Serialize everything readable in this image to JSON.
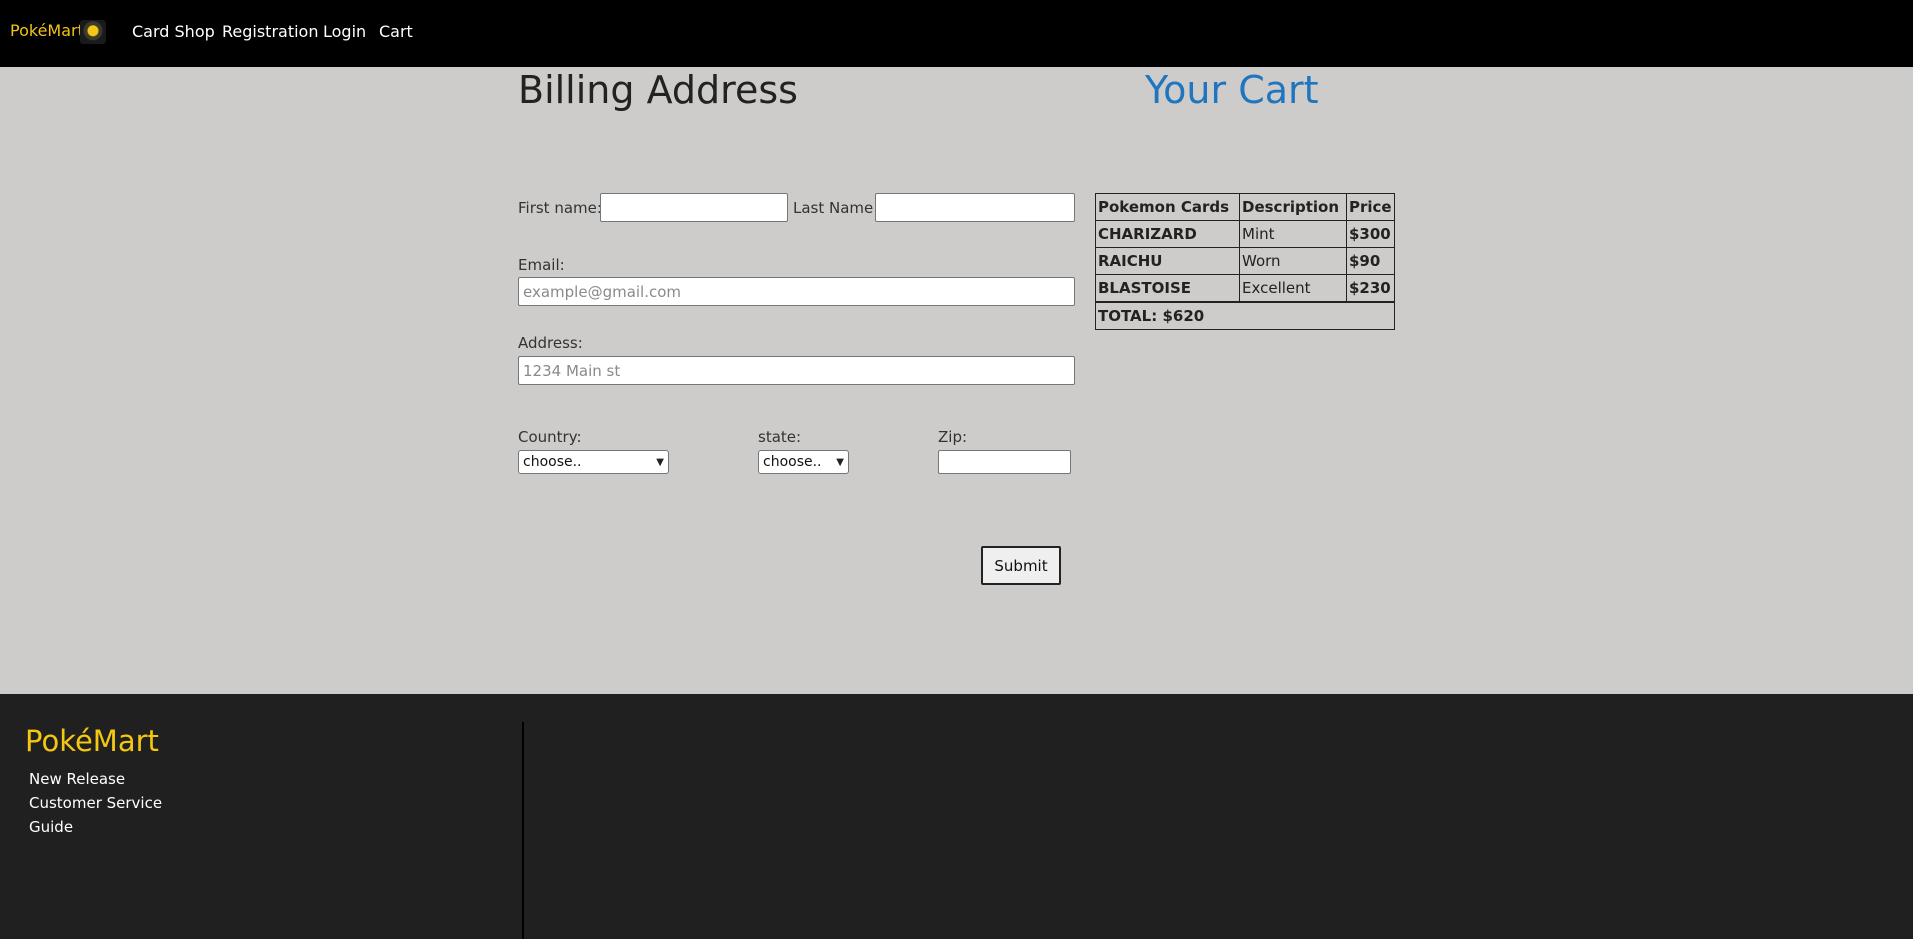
{
  "nav": {
    "brand": "PokéMart",
    "links": [
      "Card Shop",
      "Registration",
      "Login",
      "Cart"
    ]
  },
  "billing": {
    "title": "Billing Address",
    "first_name_label": "First name:",
    "first_name_value": "",
    "last_name_label": "Last Name:",
    "last_name_value": "",
    "email_label": "Email:",
    "email_placeholder": "example@gmail.com",
    "address_label": "Address:",
    "address_placeholder": "1234 Main st",
    "country_label": "Country:",
    "country_selected": "choose..",
    "state_label": "state:",
    "state_selected": "choose..",
    "zip_label": "Zip:",
    "zip_value": "",
    "submit_label": "Submit"
  },
  "cart": {
    "title": "Your Cart",
    "headers": [
      "Pokemon Cards",
      "Description",
      "Price"
    ],
    "rows": [
      {
        "card": "CHARIZARD",
        "description": "Mint",
        "price": "$300"
      },
      {
        "card": "RAICHU",
        "description": "Worn",
        "price": "$90"
      },
      {
        "card": "BLASTOISE",
        "description": "Excellent",
        "price": "$230"
      }
    ],
    "total": "TOTAL: $620"
  },
  "footer": {
    "brand": "PokéMart",
    "links": [
      "New Release",
      "Customer Service",
      "Guide"
    ]
  },
  "colors": {
    "brand_yellow": "#f0c419",
    "cart_title_blue": "#1f76bf",
    "page_bg": "#cdcccb",
    "footer_bg": "#202020"
  }
}
